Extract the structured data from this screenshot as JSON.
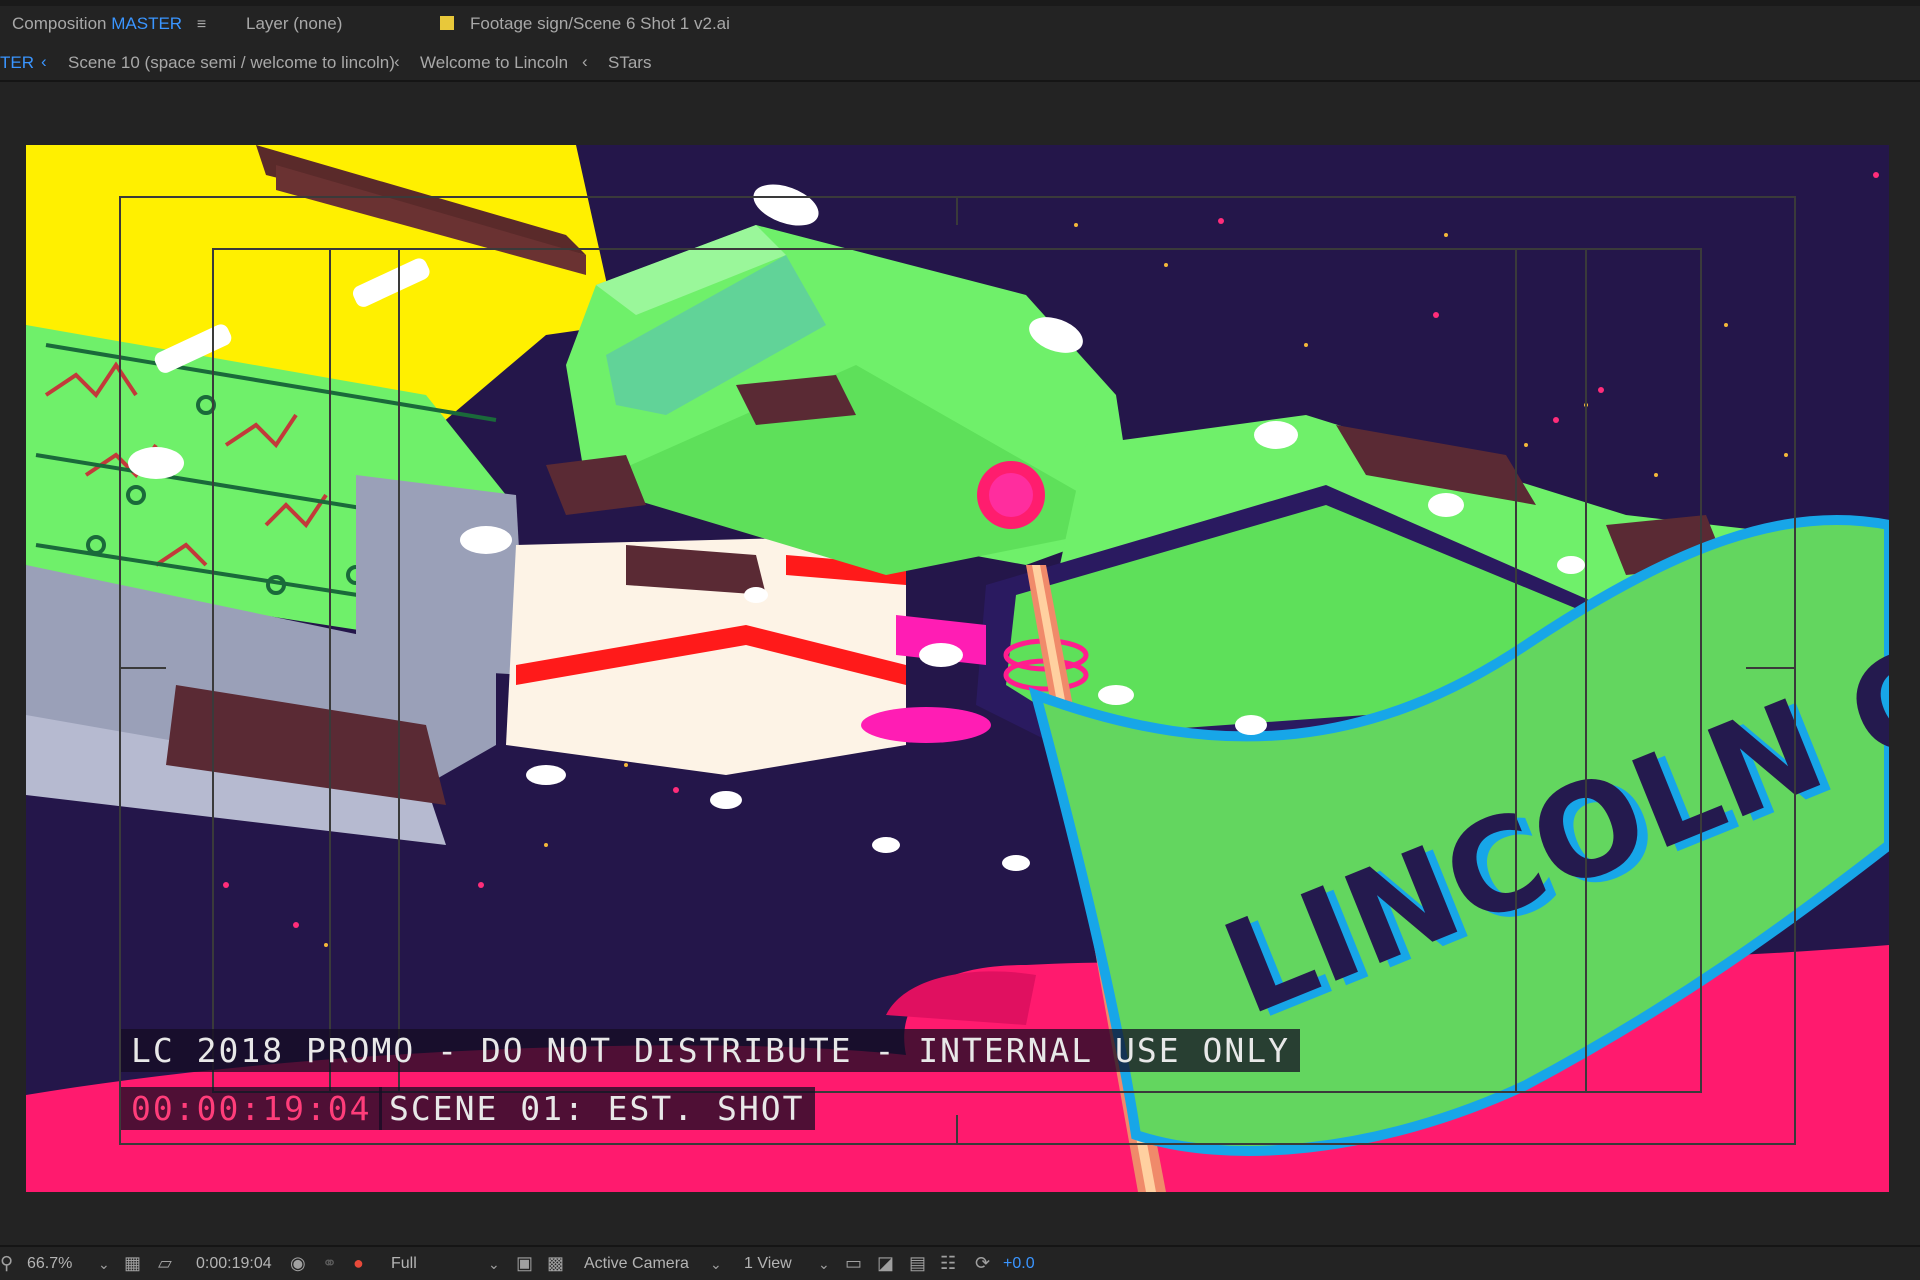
{
  "tabs": {
    "composition_prefix": "Composition",
    "composition_name": "MASTER",
    "layer": "Layer (none)",
    "footage": "Footage sign/Scene 6 Shot 1 v2.ai"
  },
  "breadcrumbs": {
    "items": [
      "TER",
      "Scene 10 (space semi / welcome to lincoln)",
      "Welcome to Lincoln",
      "STars"
    ]
  },
  "canvas": {
    "banner_text": "LINCOLN CA",
    "burnins": {
      "promo": "LC 2018 PROMO - DO NOT DISTRIBUTE - INTERNAL USE ONLY",
      "timecode": "00:00:19:04",
      "scene": "SCENE 01: EST. SHOT"
    },
    "colors": {
      "space": "#24164a",
      "ship_green": "#6ff06a",
      "yellow": "#fff000",
      "magenta": "#ff1d6e",
      "pink_ground": "#ff1a6e",
      "banner_green": "#63d65f",
      "banner_outline": "#17a6e8",
      "banner_text": "#241a4e"
    }
  },
  "status": {
    "zoom": "66.7%",
    "time": "0:00:19:04",
    "resolution": "Full",
    "camera": "Active Camera",
    "views": "1 View",
    "exposure": "+0.0"
  }
}
